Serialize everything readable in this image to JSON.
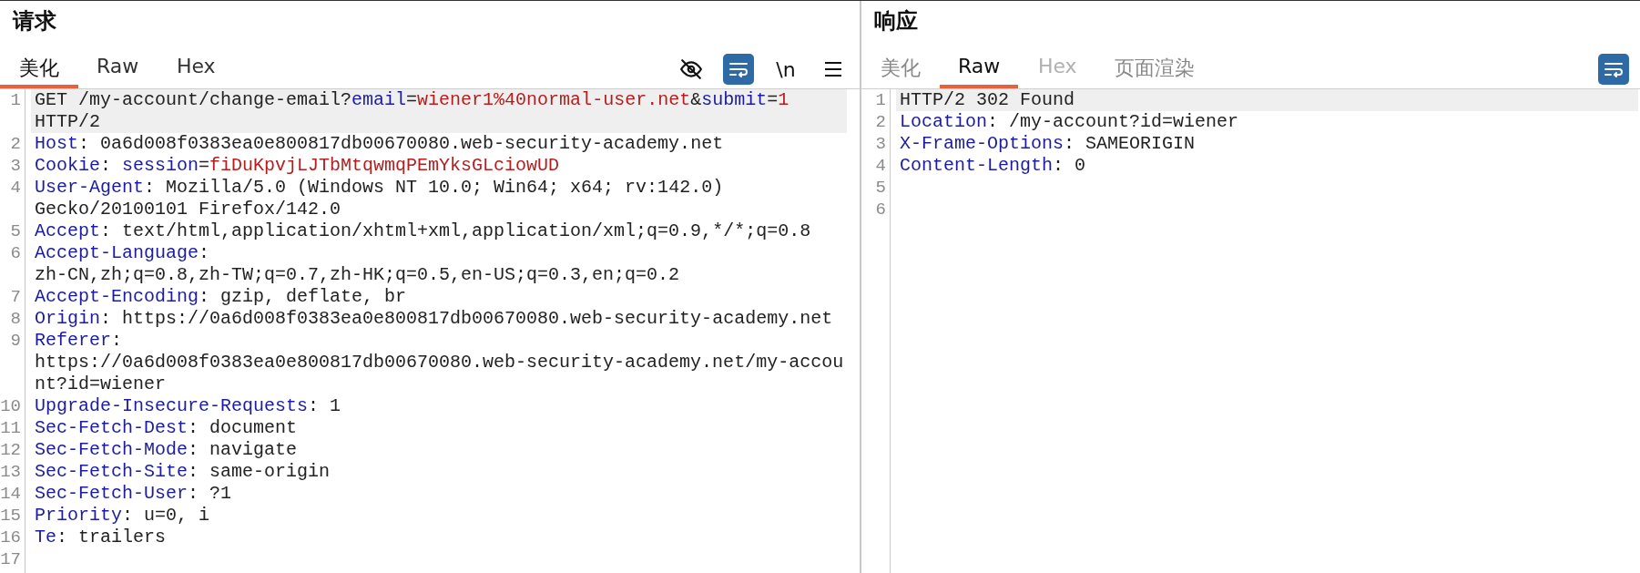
{
  "panes": [
    {
      "title": "请求",
      "focused": true,
      "tabs": [
        {
          "label": "美化",
          "selected": true,
          "disabled": false
        },
        {
          "label": "Raw",
          "selected": false,
          "disabled": false
        },
        {
          "label": "Hex",
          "selected": false,
          "disabled": false
        }
      ],
      "tools": [
        {
          "kind": "eye-off",
          "selected": false
        },
        {
          "kind": "wrap",
          "selected": true
        },
        {
          "kind": "newline",
          "label": "\\n",
          "selected": false
        },
        {
          "kind": "menu",
          "selected": false
        }
      ],
      "lines": [
        {
          "number": "1",
          "current": true,
          "rows": [
            [
              {
                "kind": "text",
                "text": "GET /my-account/change-email?"
              },
              {
                "kind": "name",
                "text": "email"
              },
              {
                "kind": "text",
                "text": "="
              },
              {
                "kind": "value",
                "text": "wiener1%40normal-user.net"
              },
              {
                "kind": "text",
                "text": "&"
              },
              {
                "kind": "name",
                "text": "submit"
              },
              {
                "kind": "text",
                "text": "="
              },
              {
                "kind": "value",
                "text": "1"
              }
            ],
            [
              {
                "kind": "text",
                "text": "HTTP/2"
              }
            ]
          ]
        },
        {
          "number": "2",
          "current": false,
          "rows": [
            [
              {
                "kind": "name",
                "text": "Host"
              },
              {
                "kind": "text",
                "text": ": 0a6d008f0383ea0e800817db00670080.web-security-academy.net"
              }
            ]
          ]
        },
        {
          "number": "3",
          "current": false,
          "rows": [
            [
              {
                "kind": "name",
                "text": "Cookie"
              },
              {
                "kind": "text",
                "text": ": "
              },
              {
                "kind": "name",
                "text": "session"
              },
              {
                "kind": "text",
                "text": "="
              },
              {
                "kind": "value",
                "text": "fiDuKpvjLJTbMtqwmqPEmYksGLciowUD"
              }
            ]
          ]
        },
        {
          "number": "4",
          "current": false,
          "rows": [
            [
              {
                "kind": "name",
                "text": "User-Agent"
              },
              {
                "kind": "text",
                "text": ": Mozilla/5.0 (Windows NT 10.0; Win64; x64; rv:142.0)"
              }
            ],
            [
              {
                "kind": "text",
                "text": "Gecko/20100101 Firefox/142.0"
              }
            ]
          ]
        },
        {
          "number": "5",
          "current": false,
          "rows": [
            [
              {
                "kind": "name",
                "text": "Accept"
              },
              {
                "kind": "text",
                "text": ": text/html,application/xhtml+xml,application/xml;q=0.9,*/*;q=0.8"
              }
            ]
          ]
        },
        {
          "number": "6",
          "current": false,
          "rows": [
            [
              {
                "kind": "name",
                "text": "Accept-Language"
              },
              {
                "kind": "text",
                "text": ":"
              }
            ],
            [
              {
                "kind": "text",
                "text": "zh-CN,zh;q=0.8,zh-TW;q=0.7,zh-HK;q=0.5,en-US;q=0.3,en;q=0.2"
              }
            ]
          ]
        },
        {
          "number": "7",
          "current": false,
          "rows": [
            [
              {
                "kind": "name",
                "text": "Accept-Encoding"
              },
              {
                "kind": "text",
                "text": ": gzip, deflate, br"
              }
            ]
          ]
        },
        {
          "number": "8",
          "current": false,
          "rows": [
            [
              {
                "kind": "name",
                "text": "Origin"
              },
              {
                "kind": "text",
                "text": ": https://0a6d008f0383ea0e800817db00670080.web-security-academy.net"
              }
            ]
          ]
        },
        {
          "number": "9",
          "current": false,
          "rows": [
            [
              {
                "kind": "name",
                "text": "Referer"
              },
              {
                "kind": "text",
                "text": ":"
              }
            ],
            [
              {
                "kind": "text",
                "text": "https://0a6d008f0383ea0e800817db00670080.web-security-academy.net/my-accou"
              }
            ],
            [
              {
                "kind": "text",
                "text": "nt?id=wiener"
              }
            ]
          ]
        },
        {
          "number": "10",
          "current": false,
          "rows": [
            [
              {
                "kind": "name",
                "text": "Upgrade-Insecure-Requests"
              },
              {
                "kind": "text",
                "text": ": 1"
              }
            ]
          ]
        },
        {
          "number": "11",
          "current": false,
          "rows": [
            [
              {
                "kind": "name",
                "text": "Sec-Fetch-Dest"
              },
              {
                "kind": "text",
                "text": ": document"
              }
            ]
          ]
        },
        {
          "number": "12",
          "current": false,
          "rows": [
            [
              {
                "kind": "name",
                "text": "Sec-Fetch-Mode"
              },
              {
                "kind": "text",
                "text": ": navigate"
              }
            ]
          ]
        },
        {
          "number": "13",
          "current": false,
          "rows": [
            [
              {
                "kind": "name",
                "text": "Sec-Fetch-Site"
              },
              {
                "kind": "text",
                "text": ": same-origin"
              }
            ]
          ]
        },
        {
          "number": "14",
          "current": false,
          "rows": [
            [
              {
                "kind": "name",
                "text": "Sec-Fetch-User"
              },
              {
                "kind": "text",
                "text": ": ?1"
              }
            ]
          ]
        },
        {
          "number": "15",
          "current": false,
          "rows": [
            [
              {
                "kind": "name",
                "text": "Priority"
              },
              {
                "kind": "text",
                "text": ": u=0, i"
              }
            ]
          ]
        },
        {
          "number": "16",
          "current": false,
          "rows": [
            [
              {
                "kind": "name",
                "text": "Te"
              },
              {
                "kind": "text",
                "text": ": trailers"
              }
            ]
          ]
        },
        {
          "number": "17",
          "current": false,
          "rows": [
            []
          ]
        }
      ]
    },
    {
      "title": "响应",
      "focused": false,
      "tabs": [
        {
          "label": "美化",
          "selected": false,
          "disabled": false
        },
        {
          "label": "Raw",
          "selected": true,
          "disabled": false
        },
        {
          "label": "Hex",
          "selected": false,
          "disabled": true
        },
        {
          "label": "页面渲染",
          "selected": false,
          "disabled": false
        }
      ],
      "tools": [
        {
          "kind": "wrap",
          "selected": true
        }
      ],
      "lines": [
        {
          "number": "1",
          "current": true,
          "rows": [
            [
              {
                "kind": "text",
                "text": "HTTP/2 302 Found"
              }
            ]
          ]
        },
        {
          "number": "2",
          "current": false,
          "rows": [
            [
              {
                "kind": "name",
                "text": "Location"
              },
              {
                "kind": "text",
                "text": ": /my-account?id=wiener"
              }
            ]
          ]
        },
        {
          "number": "3",
          "current": false,
          "rows": [
            [
              {
                "kind": "name",
                "text": "X-Frame-Options"
              },
              {
                "kind": "text",
                "text": ": SAMEORIGIN"
              }
            ]
          ]
        },
        {
          "number": "4",
          "current": false,
          "rows": [
            [
              {
                "kind": "name",
                "text": "Content-Length"
              },
              {
                "kind": "text",
                "text": ": 0"
              }
            ]
          ]
        },
        {
          "number": "5",
          "current": false,
          "rows": [
            []
          ]
        },
        {
          "number": "6",
          "current": false,
          "rows": [
            []
          ]
        }
      ]
    }
  ]
}
